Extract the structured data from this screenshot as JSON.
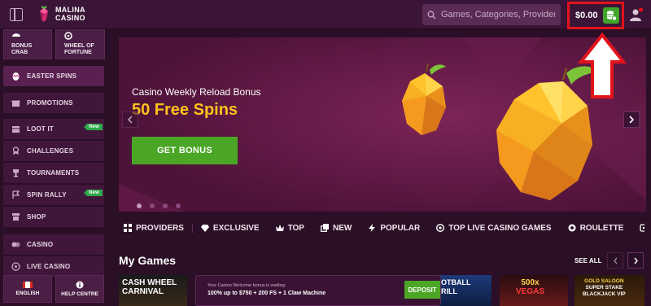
{
  "brand": {
    "line1": "MALINA",
    "line2": "CASINO"
  },
  "search": {
    "placeholder": "Games, Categories, Providers"
  },
  "balance": {
    "amount": "$0.00"
  },
  "sidebar": {
    "tiles": [
      {
        "label_line1": "BONUS",
        "label_line2": "CRAB",
        "icon": "crab-icon"
      },
      {
        "label_line1": "WHEEL OF",
        "label_line2": "FORTUNE",
        "icon": "wheel-icon"
      }
    ],
    "easter": "EASTER SPINS",
    "items": [
      {
        "label": "PROMOTIONS",
        "icon": "gift-icon"
      },
      {
        "label": "LOOT IT",
        "icon": "loot-icon",
        "badge": "New"
      },
      {
        "label": "CHALLENGES",
        "icon": "medal-icon"
      },
      {
        "label": "TOURNAMENTS",
        "icon": "trophy-icon"
      },
      {
        "label": "SPIN RALLY",
        "icon": "rally-icon",
        "badge": "New"
      },
      {
        "label": "SHOP",
        "icon": "shop-icon"
      },
      {
        "label": "CASINO",
        "icon": "casino-icon"
      },
      {
        "label": "LIVE CASINO",
        "icon": "live-casino-icon"
      }
    ],
    "footer": {
      "language": "ENGLISH",
      "help": "HELP CENTRE"
    }
  },
  "hero": {
    "subtitle": "Casino Weekly Reload Bonus",
    "title": "50 Free Spins",
    "button": "GET BONUS",
    "slides": 4,
    "active_slide": 1
  },
  "categories": [
    {
      "label": "PROVIDERS",
      "icon": "providers-icon"
    },
    {
      "label": "EXCLUSIVE",
      "icon": "diamond-icon"
    },
    {
      "label": "TOP",
      "icon": "crown-icon"
    },
    {
      "label": "NEW",
      "icon": "new-icon"
    },
    {
      "label": "POPULAR",
      "icon": "bolt-icon"
    },
    {
      "label": "TOP LIVE CASINO GAMES",
      "icon": "chip-icon"
    },
    {
      "label": "ROULETTE",
      "icon": "roulette-icon"
    },
    {
      "label": "GA",
      "icon": "games-icon"
    }
  ],
  "my_games": {
    "title": "My Games",
    "see_all": "SEE ALL",
    "games": [
      {
        "title_line1": "CASH WHEEL",
        "title_line2": "CARNIVAL"
      },
      {
        "title_line1": "OTBALL",
        "title_line2": "RILL"
      },
      {
        "title_line1": "",
        "title_line2": ""
      },
      {
        "title_line1": "500x",
        "title_line2": "VEGAS"
      },
      {
        "title_line1": "GOLD SALOON",
        "title_line2": "SUPER STAKE",
        "title_line3": "BLACKJACK VIP"
      }
    ]
  },
  "deposit_toast": {
    "line1": "Your Casino Welcome bonus is waiting:",
    "line2": "100% up to $750 + 200 FS + 1 Claw Machine",
    "button": "DEPOSIT"
  },
  "colors": {
    "accent_green": "#4ba626",
    "highlight_yellow": "#ffc21c",
    "annotation_red": "#e3131b",
    "page_bg": "#2b0f26"
  }
}
